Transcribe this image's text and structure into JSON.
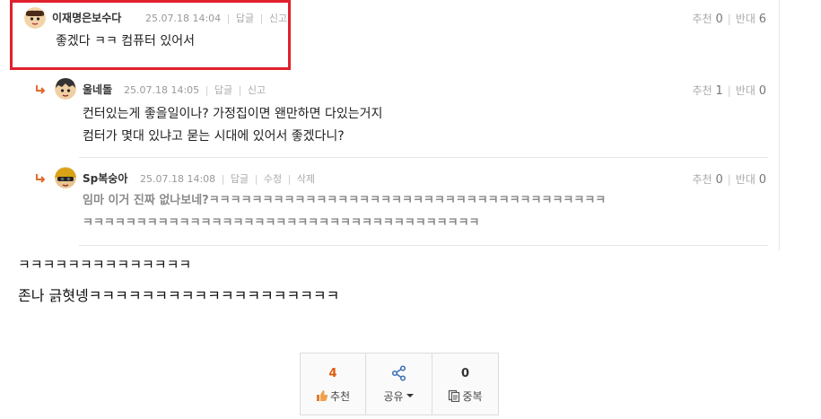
{
  "comments": [
    {
      "nick": "이재명은보수다",
      "date": "25.07.18 14:04",
      "actions": [
        "답글",
        "신고"
      ],
      "rec_label": "추천",
      "rec_count": "0",
      "opp_label": "반대",
      "opp_count": "6",
      "lines": [
        "좋겠다 ㅋㅋ 컴퓨터 있어서"
      ]
    },
    {
      "nick": "울네돌",
      "date": "25.07.18 14:05",
      "actions": [
        "답글",
        "신고"
      ],
      "rec_label": "추천",
      "rec_count": "1",
      "opp_label": "반대",
      "opp_count": "0",
      "lines": [
        "컨터있는게 좋을일이나? 가정집이면 왠만하면 다있는거지",
        "컴터가 몇대 있냐고 묻는 시대에 있어서 좋겠다니?"
      ]
    },
    {
      "nick": "Sp복숭아",
      "date": "25.07.18 14:08",
      "actions": [
        "답글",
        "수정",
        "삭제"
      ],
      "rec_label": "추천",
      "rec_count": "0",
      "opp_label": "반대",
      "opp_count": "0",
      "lines": [
        "임마 이거 진짜 없나보네?ㅋㅋㅋㅋㅋㅋㅋㅋㅋㅋㅋㅋㅋㅋㅋㅋㅋㅋㅋㅋㅋㅋㅋㅋㅋㅋㅋㅋㅋㅋㅋㅋㅋㅋㅋㅋㅋ",
        "ㅋㅋㅋㅋㅋㅋㅋㅋㅋㅋㅋㅋㅋㅋㅋㅋㅋㅋㅋㅋㅋㅋㅋㅋㅋㅋㅋㅋㅋㅋㅋㅋㅋㅋㅋㅋㅋ"
      ]
    }
  ],
  "post": {
    "line1": "ㅋㅋㅋㅋㅋㅋㅋㅋㅋㅋㅋㅋㅋㅋ",
    "line2": "존나 긁혓넹ㅋㅋㅋㅋㅋㅋㅋㅋㅋㅋㅋㅋㅋㅋㅋㅋㅋㅋㅋ"
  },
  "buttons": {
    "recommend": {
      "count": "4",
      "label": "추천"
    },
    "share": {
      "label": "공유"
    },
    "duplicate": {
      "count": "0",
      "label": "중복"
    }
  },
  "colors": {
    "highlight": "#e0202d",
    "recommend_count": "#e05a0c",
    "reply_arrow": "#e06a2c"
  }
}
